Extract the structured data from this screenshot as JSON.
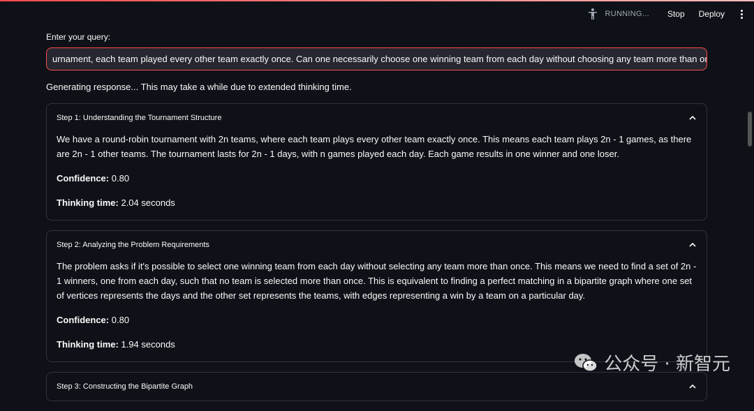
{
  "toolbar": {
    "running_label": "RUNNING...",
    "stop_label": "Stop",
    "deploy_label": "Deploy"
  },
  "query": {
    "label": "Enter your query:",
    "value": "urnament, each team played every other team exactly once. Can one necessarily choose one winning team from each day without choosing any team more than once?"
  },
  "status": "Generating response... This may take a while due to extended thinking time.",
  "steps": [
    {
      "title": "Step 1: Understanding the Tournament Structure",
      "content": "We have a round-robin tournament with 2n teams, where each team plays every other team exactly once. This means each team plays 2n - 1 games, as there are 2n - 1 other teams. The tournament lasts for 2n - 1 days, with n games played each day. Each game results in one winner and one loser.",
      "confidence_label": "Confidence:",
      "confidence_value": "0.80",
      "time_label": "Thinking time:",
      "time_value": "2.04 seconds"
    },
    {
      "title": "Step 2: Analyzing the Problem Requirements",
      "content": "The problem asks if it's possible to select one winning team from each day without selecting any team more than once. This means we need to find a set of 2n - 1 winners, one from each day, such that no team is selected more than once. This is equivalent to finding a perfect matching in a bipartite graph where one set of vertices represents the days and the other set represents the teams, with edges representing a win by a team on a particular day.",
      "confidence_label": "Confidence:",
      "confidence_value": "0.80",
      "time_label": "Thinking time:",
      "time_value": "1.94 seconds"
    },
    {
      "title": "Step 3: Constructing the Bipartite Graph"
    }
  ],
  "watermark": "公众号 · 新智元",
  "colors": {
    "background": "#0e1117",
    "accent": "#ff4b4b",
    "border": "#31333f",
    "input_bg": "#262730"
  },
  "icons": [
    "running-man-icon",
    "kebab-menu-icon",
    "chevron-up-icon",
    "wechat-icon"
  ]
}
